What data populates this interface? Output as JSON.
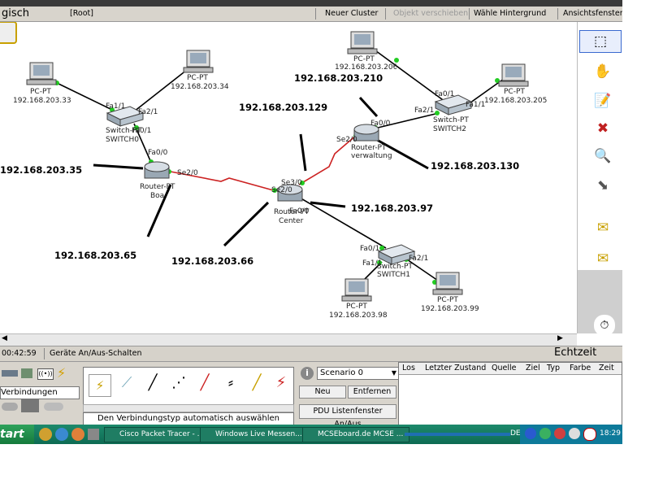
{
  "menubar": {
    "logical": "gisch",
    "root": "[Root]",
    "new_cluster": "Neuer Cluster",
    "move_object": "Objekt verschieben",
    "choose_bg": "Wähle Hintergrund",
    "view_window": "Ansichtsfenster"
  },
  "devices": {
    "pc1": {
      "type": "PC-PT",
      "ip": "192.168.203.33"
    },
    "pc2": {
      "type": "PC-PT",
      "ip": "192.168.203.34"
    },
    "pc3": {
      "type": "PC-PT",
      "ip": "192.168.203.206"
    },
    "pc4": {
      "type": "PC-PT",
      "ip": "192.168.203.205"
    },
    "pc5": {
      "type": "PC-PT",
      "ip": "192.168.203.98"
    },
    "pc6": {
      "type": "PC-PT",
      "ip": "192.168.203.99"
    },
    "switch0": {
      "type": "Switch-PT",
      "name": "SWITCH0"
    },
    "switch1": {
      "type": "Switch-PT",
      "name": "SWITCH1"
    },
    "switch2": {
      "type": "Switch-PT",
      "name": "SWITCH2"
    },
    "router_boa": {
      "type": "Router-PT",
      "name": "Boa"
    },
    "router_center": {
      "type": "Router-PT",
      "name": "Center"
    },
    "router_verw": {
      "type": "Router-PT",
      "name": "verwaltung"
    }
  },
  "ports": {
    "s0_fa11": "Fa1/1",
    "s0_fa21": "Fa2/1",
    "s0_fa01": "Fa0/1",
    "boa_fa00": "Fa0/0",
    "boa_se20": "Se2/0",
    "c_se30": "Se3/0",
    "c_se20": "Se2/0",
    "c_fa00": "Fa0/0",
    "v_fa00": "Fa0/0",
    "v_se20": "Se2/0",
    "s2_fa01": "Fa0/1",
    "s2_fa21": "Fa2/1",
    "s2_fa11": "Fa1/1",
    "s1_fa01": "Fa0/1",
    "s1_fa11": "Fa1/1",
    "s1_fa21": "Fa2/1"
  },
  "annotations": {
    "ip_210": "192.168.203.210",
    "ip_129": "192.168.203.129",
    "ip_35": "192.168.203.35",
    "ip_130": "192.168.203.130",
    "ip_97": "192.168.203.97",
    "ip_65": "192.168.203.65",
    "ip_66": "192.168.203.66"
  },
  "status": {
    "time": "00:42:59",
    "power_cycle": "Geräte An/Aus-Schalten",
    "realtime": "Echtzeit"
  },
  "bottom": {
    "connections_label": "Verbindungen",
    "auto_conn_hint": "Den Verbindungstyp automatisch auswählen",
    "scenario": "Scenario 0",
    "new_btn": "Neu",
    "delete_btn": "Entfernen",
    "pdu_btn": "PDU Listenfenster An/Aus",
    "columns": [
      "Los",
      "Letzter Zustand",
      "Quelle",
      "Ziel",
      "Typ",
      "Farbe",
      "Zeit"
    ]
  },
  "taskbar": {
    "start": "tart",
    "tasks": [
      "Cisco Packet Tracer - ...",
      "Windows Live Messen...",
      "MCSEboard.de MCSE ..."
    ],
    "lang": "DE",
    "clock": "18:29"
  },
  "colors": {
    "serial_link": "#cc2222",
    "link_up": "#22cc22",
    "taskbar": "#0e6b53"
  }
}
